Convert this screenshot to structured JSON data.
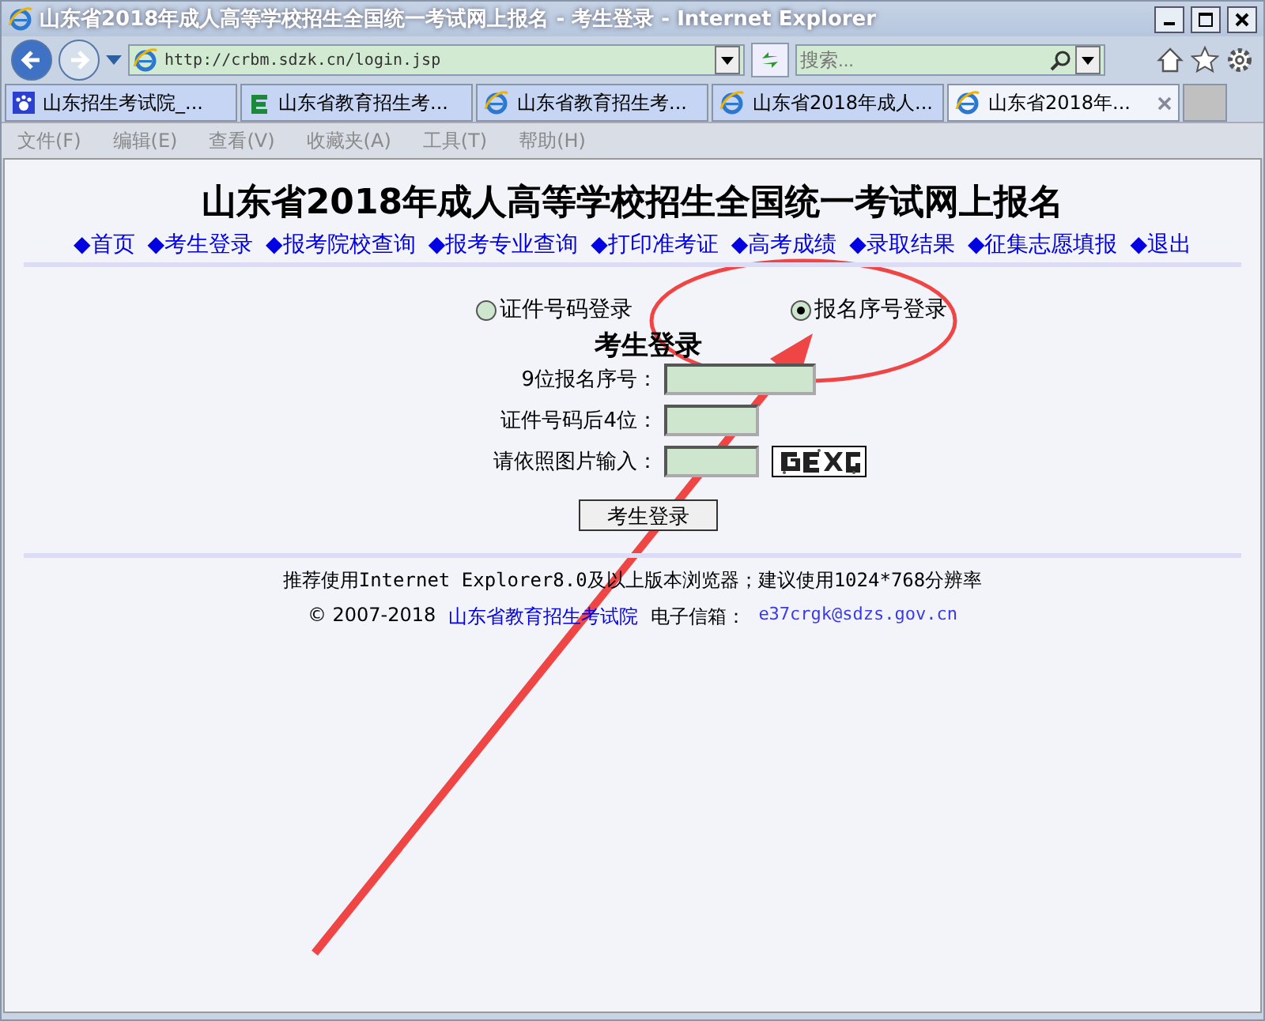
{
  "window": {
    "title": "山东省2018年成人高等学校招生全国统一考试网上报名 - 考生登录 - Internet Explorer"
  },
  "address_bar": {
    "url": "http://crbm.sdzk.cn/login.jsp",
    "search_placeholder": "搜索..."
  },
  "tabs": [
    {
      "label": "山东招生考试院_...",
      "selected": false,
      "kind": "paw"
    },
    {
      "label": "山东省教育招生考...",
      "selected": false,
      "kind": "letter"
    },
    {
      "label": "山东省教育招生考...",
      "selected": false,
      "kind": "ie"
    },
    {
      "label": "山东省2018年成人...",
      "selected": false,
      "kind": "ie"
    },
    {
      "label": "山东省2018年...",
      "selected": true,
      "kind": "ie"
    }
  ],
  "menu": [
    "文件(F)",
    "编辑(E)",
    "查看(V)",
    "收藏夹(A)",
    "工具(T)",
    "帮助(H)"
  ],
  "page": {
    "heading": "山东省2018年成人高等学校招生全国统一考试网上报名",
    "nav": [
      "◆首页",
      "◆考生登录",
      "◆报考院校查询",
      "◆报考专业查询",
      "◆打印准考证",
      "◆高考成绩",
      "◆录取结果",
      "◆征集志愿填报",
      "◆退出"
    ],
    "login_modes": [
      {
        "label": "证件号码登录",
        "selected": false
      },
      {
        "label": "报名序号登录",
        "selected": true
      }
    ],
    "form_title": "考生登录",
    "fields": [
      {
        "label": "9位报名序号：",
        "kind": "wide"
      },
      {
        "label": "证件号码后4位：",
        "kind": "short"
      },
      {
        "label": "请依照图片输入：",
        "kind": "captcha"
      }
    ],
    "submit": "考生登录",
    "footer": {
      "browser_note": "推荐使用Internet Explorer8.0及以上版本浏览器；建议使用1024*768分辨率",
      "copyright": "© 2007-2018",
      "org": "山东省教育招生考试院",
      "email_label": "电子信箱：",
      "email": "e37crgk@sdzs.gov.cn"
    }
  }
}
